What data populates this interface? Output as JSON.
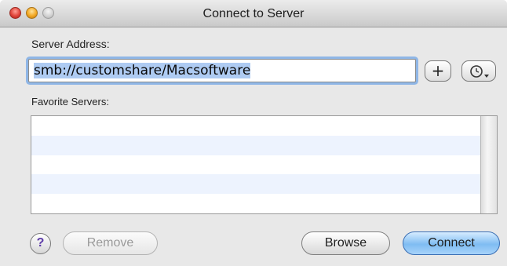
{
  "window": {
    "title": "Connect to Server"
  },
  "server_address": {
    "label": "Server Address:",
    "value": "smb://customshare/Macsoftware",
    "add_button": "+",
    "recent_servers_icon": "clock-icon"
  },
  "favorites": {
    "label": "Favorite Servers:",
    "rows": [
      "",
      "",
      "",
      "",
      ""
    ]
  },
  "buttons": {
    "help": "?",
    "remove": "Remove",
    "browse": "Browse",
    "connect": "Connect"
  }
}
